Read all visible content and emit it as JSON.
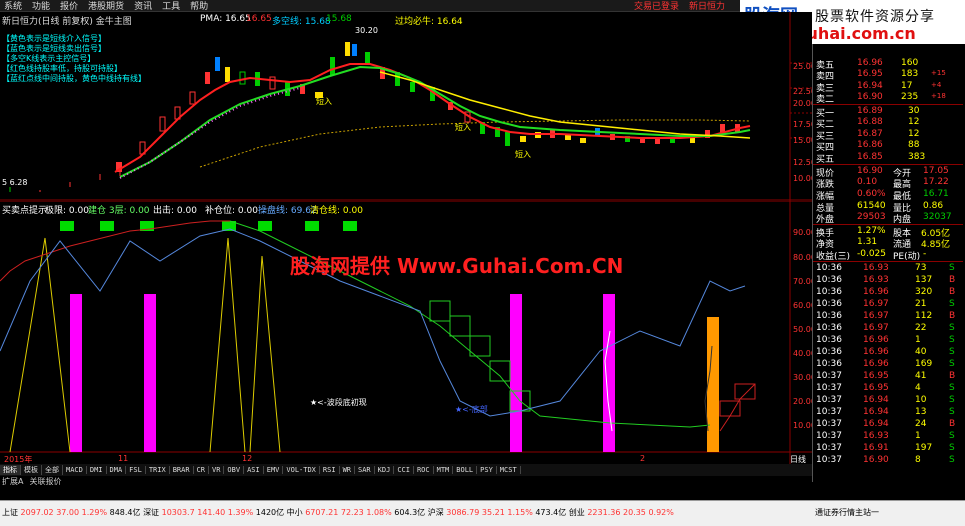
{
  "menu": {
    "items": [
      "系统",
      "功能",
      "报价",
      "港股期货",
      "资讯",
      "工具",
      "帮助"
    ],
    "right_items": [
      "交易已登录",
      "新日恒力"
    ]
  },
  "logo": {
    "brand": "股海网",
    "slogan": "股票软件资源分享",
    "url": "www.Guhai.com.cn"
  },
  "main_chart": {
    "title": "新日恒力(日线 前复权) 金牛主图",
    "pma": "PMA: 16.65",
    "pma2": "16.65",
    "duokong": "多空线: 15.68",
    "duokong2": "15.68",
    "guoqu": "过均必牛: 16.64",
    "peak_label": "30.20",
    "low_label": "5 6.28",
    "notes": [
      "【黄色表示是短线介入信号】",
      "【蓝色表示是短线卖出信号】",
      "【多空K线表示主控信号】",
      "【红色线持股率低，持股可持股】",
      "【蓝红点线中间持股，黄色中线持有线】"
    ],
    "buy_labels": [
      "短入",
      "短入",
      "短入"
    ],
    "y_ticks": [
      "25.00",
      "22.50",
      "20.00",
      "17.50",
      "15.00",
      "12.50",
      "10.00"
    ]
  },
  "ind_chart": {
    "title": "买卖点提示",
    "items": [
      "极限: 0.00",
      "建仓 3层: 0.00",
      "出击: 0.00",
      "补仓位: 0.00",
      "操盘线: 69.62",
      "清仓线: 0.00"
    ],
    "y_ticks": [
      "90.00",
      "80.00",
      "70.00",
      "60.00",
      "50.00",
      "40.00",
      "30.00",
      "20.00",
      "10.00"
    ],
    "x_ticks": [
      "2015年",
      "11",
      "12",
      "2"
    ],
    "note1": "★<-波段底初现",
    "note2": "★<-底部",
    "period": "日线"
  },
  "watermark": "股海网提供 Www.Guhai.Com.CN",
  "tabs": [
    "指标",
    "模板",
    "全部",
    "MACD",
    "DMI",
    "DMA",
    "FSL",
    "TRIX",
    "BRAR",
    "CR",
    "VR",
    "OBV",
    "ASI",
    "EMV",
    "VOL-TDX",
    "RSI",
    "WR",
    "SAR",
    "KDJ",
    "CCI",
    "ROC",
    "MTM",
    "BOLL",
    "PSY",
    "MCST"
  ],
  "tabs2": [
    "扩展A",
    "关联报价"
  ],
  "quotes": {
    "sells": [
      {
        "label": "卖五",
        "price": "16.96",
        "vol": "160",
        "chg": ""
      },
      {
        "label": "卖四",
        "price": "16.95",
        "vol": "183",
        "chg": "+15"
      },
      {
        "label": "卖三",
        "price": "16.94",
        "vol": "17",
        "chg": "+4"
      },
      {
        "label": "卖二",
        "price": "16.90",
        "vol": "235",
        "chg": "+18"
      }
    ],
    "buys": [
      {
        "label": "买一",
        "price": "16.89",
        "vol": "30"
      },
      {
        "label": "买二",
        "price": "16.88",
        "vol": "12"
      },
      {
        "label": "买三",
        "price": "16.87",
        "vol": "12"
      },
      {
        "label": "买四",
        "price": "16.86",
        "vol": "88"
      },
      {
        "label": "买五",
        "price": "16.85",
        "vol": "383"
      }
    ],
    "stats": [
      {
        "l1": "现价",
        "v1": "16.90",
        "l2": "今开",
        "v2": "17.05"
      },
      {
        "l1": "涨跌",
        "v1": "0.10",
        "l2": "最高",
        "v2": "17.22"
      },
      {
        "l1": "涨幅",
        "v1": "0.60%",
        "l2": "最低",
        "v2": "16.71"
      },
      {
        "l1": "总量",
        "v1": "61540",
        "l2": "量比",
        "v2": "0.86"
      },
      {
        "l1": "外盘",
        "v1": "29503",
        "l2": "内盘",
        "v2": "32037"
      },
      {
        "l1": "换手",
        "v1": "1.27%",
        "l2": "股本",
        "v2": "6.05亿"
      },
      {
        "l1": "净资",
        "v1": "1.31",
        "l2": "流通",
        "v2": "4.85亿"
      },
      {
        "l1": "收益(三)",
        "v1": "-0.025",
        "l2": "PE(动)",
        "v2": "-"
      }
    ],
    "ticks": [
      {
        "t": "10:36",
        "p": "16.93",
        "v": "73",
        "s": "S"
      },
      {
        "t": "10:36",
        "p": "16.93",
        "v": "137",
        "s": "B"
      },
      {
        "t": "10:36",
        "p": "16.96",
        "v": "320",
        "s": "B"
      },
      {
        "t": "10:36",
        "p": "16.97",
        "v": "21",
        "s": "S"
      },
      {
        "t": "10:36",
        "p": "16.97",
        "v": "112",
        "s": "B"
      },
      {
        "t": "10:36",
        "p": "16.97",
        "v": "22",
        "s": "S"
      },
      {
        "t": "10:36",
        "p": "16.96",
        "v": "1",
        "s": "S"
      },
      {
        "t": "10:36",
        "p": "16.96",
        "v": "40",
        "s": "S"
      },
      {
        "t": "10:36",
        "p": "16.96",
        "v": "169",
        "s": "S"
      },
      {
        "t": "10:37",
        "p": "16.95",
        "v": "41",
        "s": "B"
      },
      {
        "t": "10:37",
        "p": "16.95",
        "v": "4",
        "s": "S"
      },
      {
        "t": "10:37",
        "p": "16.94",
        "v": "10",
        "s": "S"
      },
      {
        "t": "10:37",
        "p": "16.94",
        "v": "13",
        "s": "S"
      },
      {
        "t": "10:37",
        "p": "16.94",
        "v": "24",
        "s": "B"
      },
      {
        "t": "10:37",
        "p": "16.93",
        "v": "1",
        "s": "S"
      },
      {
        "t": "10:37",
        "p": "16.91",
        "v": "197",
        "s": "S"
      },
      {
        "t": "10:37",
        "p": "16.90",
        "v": "8",
        "s": "S"
      }
    ]
  },
  "statusbar": {
    "sh": {
      "name": "上证",
      "v": "2097.02",
      "c": "37.00",
      "p": "1.29%",
      "amt": "848.4亿"
    },
    "sz": {
      "name": "深证",
      "v": "10303.7",
      "c": "141.40",
      "p": "1.39%",
      "amt": "1420亿"
    },
    "zx": {
      "name": "中小",
      "v": "6707.21",
      "c": "72.23",
      "p": "1.08%",
      "amt": "604.3亿"
    },
    "hs": {
      "name": "沪深",
      "v": "3086.79",
      "c": "35.21",
      "p": "1.15%",
      "amt": "473.4亿"
    },
    "cy": {
      "name": "创业",
      "v": "2231.36",
      "c": "20.35",
      "p": "0.92%"
    },
    "site": "通证券行情主站一"
  },
  "colors": {
    "up": "#ff3333",
    "down": "#00cc00",
    "ma_red": "#ff2020",
    "ma_green": "#22dd22",
    "ma_yellow": "#ffee00",
    "magenta": "#ff00ff",
    "orange": "#ff9900"
  }
}
